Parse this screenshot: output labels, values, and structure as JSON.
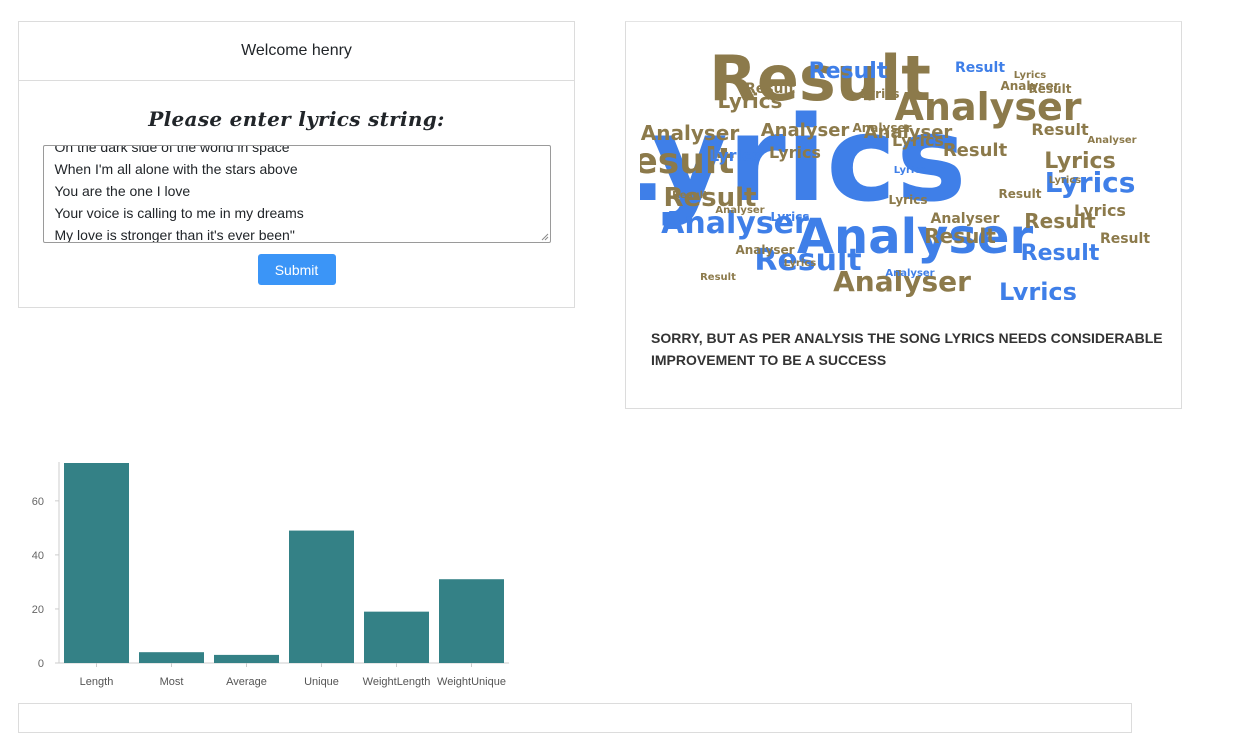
{
  "welcome": {
    "header": "Welcome henry",
    "prompt": "Please enter lyrics string:",
    "lyrics_lines": [
      "On the dark side of the world in space",
      "When I'm all alone with the stars above",
      "You are the one I love",
      "Your voice is calling to me in my dreams",
      "My love is stronger than it's ever been\""
    ],
    "submit_label": "Submit"
  },
  "result": {
    "message": "Sorry, but as per analysis the song lyrics needs considerable improvement to be a success",
    "wordcloud_words": [
      "Lyrics",
      "Result",
      "Analyser"
    ],
    "colors": {
      "blue": "#3f7fe8",
      "brown": "#8c7a4b"
    }
  },
  "chart_data": {
    "type": "bar",
    "categories": [
      "Length",
      "Most",
      "Average",
      "Unique",
      "WeightLength",
      "WeightUnique"
    ],
    "values": [
      74,
      4,
      3,
      49,
      19,
      31
    ],
    "yticks": [
      0,
      20,
      40,
      60
    ],
    "ylim": [
      0,
      74
    ],
    "grid": false,
    "colors": {
      "bar": "#348186"
    }
  }
}
